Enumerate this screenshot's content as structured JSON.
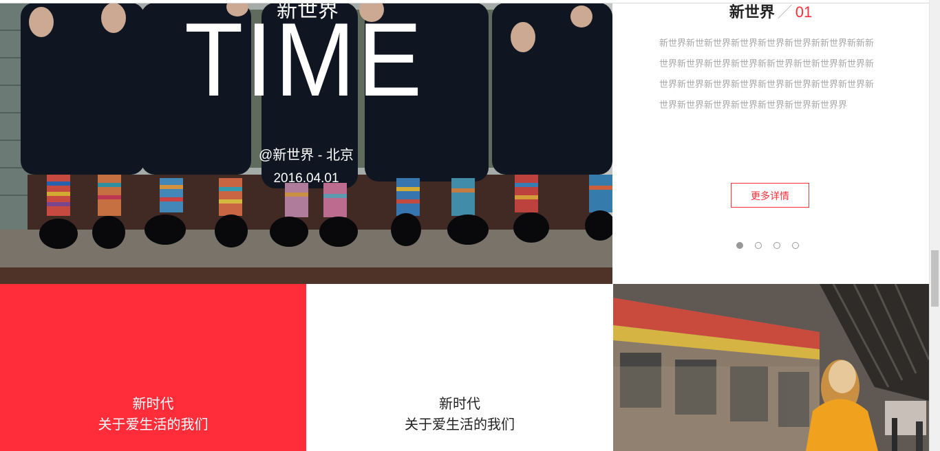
{
  "hero": {
    "top_text": "新世界",
    "big_text": "TIME",
    "location": "@新世界 - 北京",
    "date": "2016.04.01"
  },
  "article": {
    "title": "新世界",
    "slash": "／",
    "number": "01",
    "body": "新世界新世新世界新世界新世界新世界新新世界新新新世界新世界新世界新世界新新世界新世新世界新世界新世界新世界新世界新世界新世界新世界新世界新世界新世界新世界新世界新世界新世界新世界新世界界",
    "more_label": "更多详情",
    "dots": [
      "slide-1",
      "slide-2",
      "slide-3",
      "slide-4"
    ],
    "active_dot": 0,
    "accent_color": "#ff2e39"
  },
  "tiles": [
    {
      "line1": "新时代",
      "line2": "关于爱生活的我们",
      "background": "#ff2d39",
      "text_color": "#ffffff"
    },
    {
      "line1": "新时代",
      "line2": "关于爱生活的我们",
      "background": "#ffffff",
      "text_color": "#222222"
    }
  ],
  "photos": {
    "hero_image": "socks-photo",
    "tile_image": "train-station-photo"
  }
}
